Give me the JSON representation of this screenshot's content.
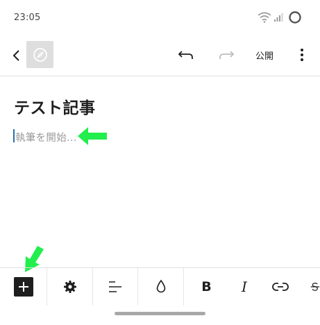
{
  "status_bar": {
    "time": "23:05",
    "icons": [
      "wifi-icon",
      "signal-icon",
      "battery-ring-icon"
    ]
  },
  "toolbar": {
    "back_icon": "chevron-left-icon",
    "site_icon": "compass-icon",
    "undo_icon": "undo-icon",
    "redo_icon": "redo-icon",
    "publish_label": "公開",
    "more_icon": "vertical-ellipsis-icon"
  },
  "editor": {
    "title": "テスト記事",
    "body_placeholder": "執筆を開始..."
  },
  "format_bar": {
    "items": [
      {
        "name": "add-block",
        "icon": "plus-icon"
      },
      {
        "name": "block-settings",
        "icon": "gear-icon"
      },
      {
        "name": "align",
        "icon": "align-left-icon"
      },
      {
        "name": "text-color",
        "icon": "droplet-icon"
      },
      {
        "name": "bold",
        "label": "B"
      },
      {
        "name": "italic",
        "label": "I"
      },
      {
        "name": "link",
        "icon": "link-icon"
      },
      {
        "name": "strikethrough",
        "icon": "strikethrough-icon"
      }
    ]
  },
  "colors": {
    "annotation_arrow": "#22ee4e",
    "caret": "#2271b1",
    "add_block_bg": "#1e1e1e"
  }
}
